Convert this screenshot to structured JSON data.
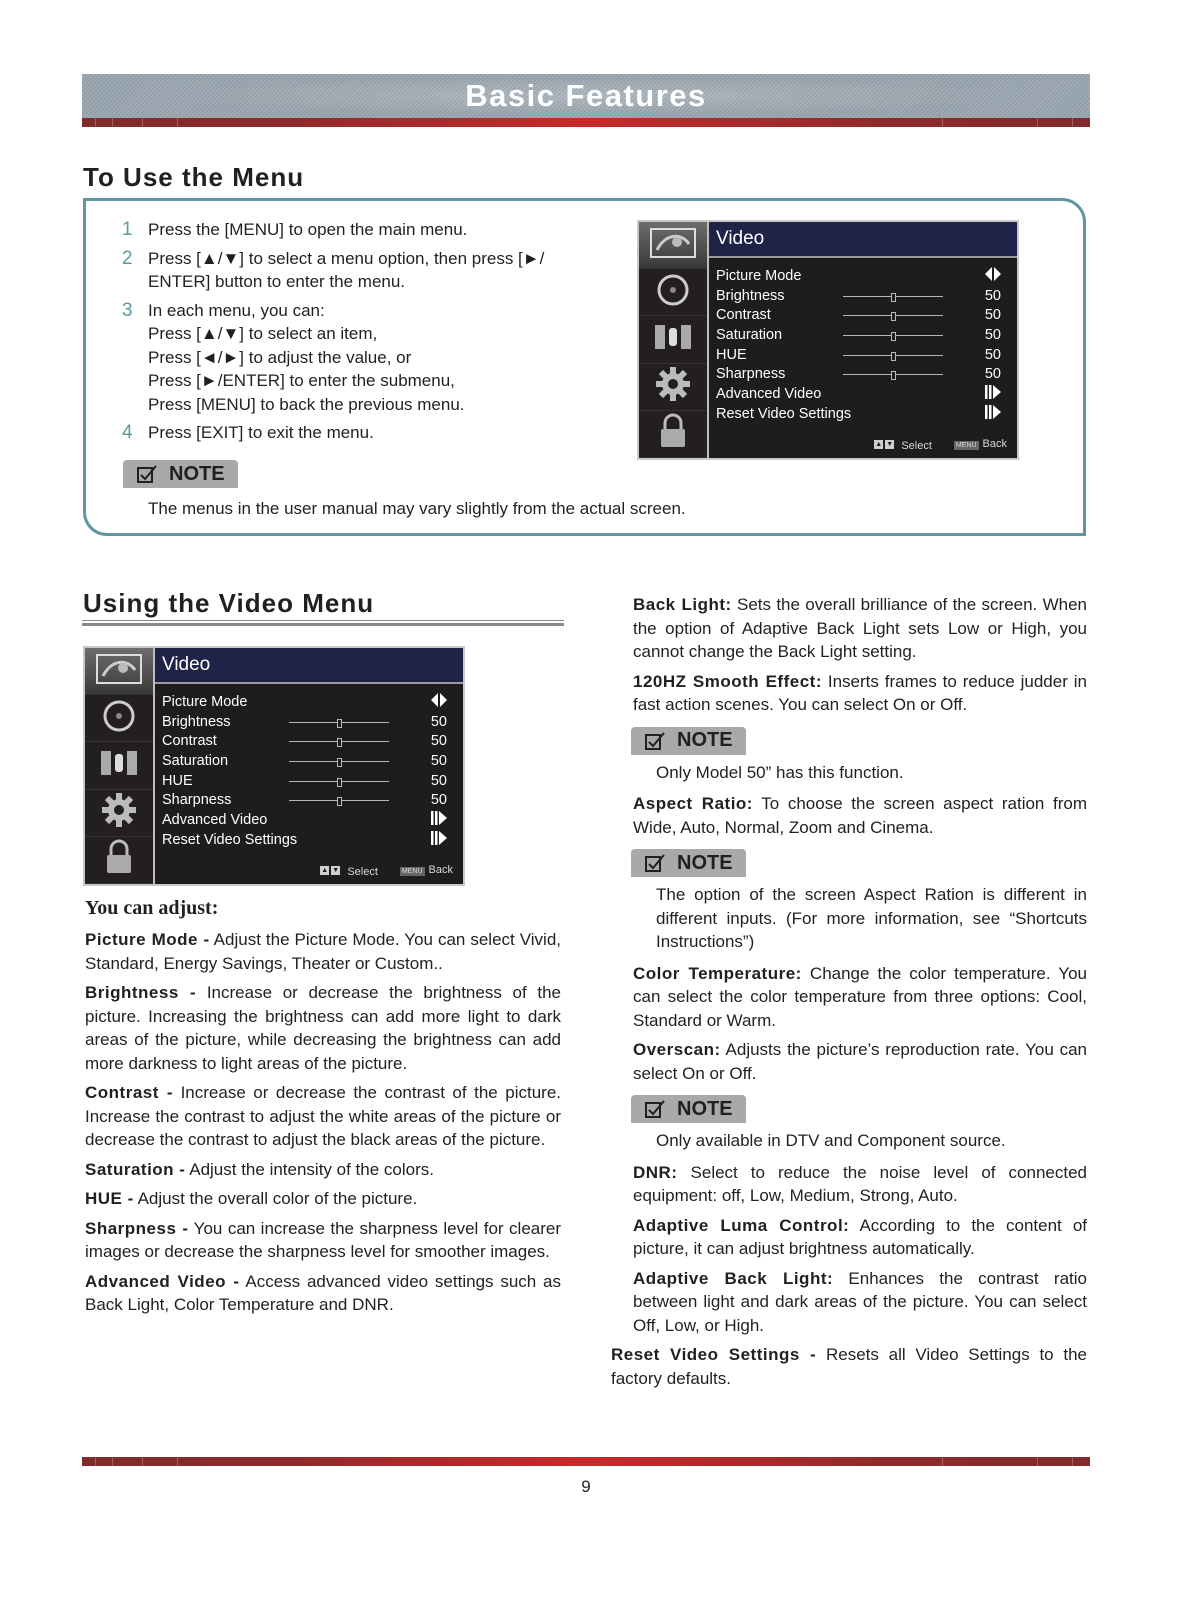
{
  "header": {
    "title": "Basic Features"
  },
  "section_menu": {
    "title": "To Use the Menu",
    "steps": [
      {
        "num": "1",
        "lines": [
          "Press the [MENU] to open the main menu."
        ]
      },
      {
        "num": "2",
        "lines": [
          "Press [▲/▼] to select a menu option, then press [►/",
          "ENTER] button to enter the menu."
        ]
      },
      {
        "num": "3",
        "lines": [
          "In each menu, you can:",
          "Press [▲/▼] to select an item,",
          "Press [◄/►] to adjust the value, or",
          "Press [►/ENTER] to enter the submenu,",
          "Press [MENU] to back the previous menu."
        ]
      },
      {
        "num": "4",
        "lines": [
          "Press [EXIT] to exit the menu."
        ]
      }
    ],
    "note_label": "NOTE",
    "note_text": "The menus in the user manual may vary slightly from the actual screen."
  },
  "osd_menu": {
    "title": "Video",
    "sidebar_icons": [
      "picture-icon",
      "sound-icon",
      "channel-icon",
      "setup-icon",
      "lock-icon"
    ],
    "rows": [
      {
        "label": "Picture Mode",
        "type": "toggle",
        "value": "◆"
      },
      {
        "label": "Brightness",
        "type": "slider",
        "value": "50",
        "level": 0.5
      },
      {
        "label": "Contrast",
        "type": "slider",
        "value": "50",
        "level": 0.5
      },
      {
        "label": "Saturation",
        "type": "slider",
        "value": "50",
        "level": 0.5
      },
      {
        "label": "HUE",
        "type": "slider",
        "value": "50",
        "level": 0.5
      },
      {
        "label": "Sharpness",
        "type": "slider",
        "value": "50",
        "level": 0.5
      },
      {
        "label": "Advanced Video",
        "type": "submenu",
        "value": ""
      },
      {
        "label": "Reset Video Settings",
        "type": "submenu",
        "value": ""
      }
    ],
    "footer": {
      "up": "▲",
      "down": "▼",
      "select_label": "Select",
      "menu_key": "MENU",
      "back_label": "Back"
    },
    "colors": {
      "title_bg": "#1f2348",
      "body_bg": "#1e1c1d"
    }
  },
  "section_video": {
    "title": "Using the Video Menu",
    "adjust_heading": "You can adjust:",
    "left_items": [
      {
        "term": "Picture Mode -",
        "text": " Adjust the Picture Mode. You can select Vivid, Standard, Energy Savings, Theater or Custom.."
      },
      {
        "term": "Brightness -",
        "text": " Increase or decrease the brightness of the picture. Increasing the brightness can add more light to dark areas of the picture, while decreasing the brightness can add more darkness to light areas of the picture."
      },
      {
        "term": "Contrast -",
        "text": " Increase or decrease the contrast of the picture. Increase the contrast to adjust the white areas of the picture or decrease the contrast to adjust the black areas of the picture."
      },
      {
        "term": "Saturation -",
        "text": " Adjust the intensity of the colors."
      },
      {
        "term": "HUE -",
        "text": " Adjust the overall color of the picture."
      },
      {
        "term": "Sharpness -",
        "text": " You can increase the sharpness level for clearer images or decrease the sharpness level for smoother images."
      },
      {
        "term": "Advanced Video -",
        "text": " Access advanced video settings such as Back Light, Color Temperature and DNR."
      }
    ],
    "right_items": [
      {
        "term": "Back Light:",
        "text": " Sets the overall brilliance of the screen. When the option of Adaptive Back Light sets Low or High, you cannot change the Back Light setting."
      },
      {
        "term": "120HZ Smooth Effect:",
        "text": " Inserts frames to reduce judder in fast action scenes. You can select On or Off."
      },
      {
        "note": "Only Model 50” has this function."
      },
      {
        "term": "Aspect Ratio:",
        "text": " To choose the screen aspect ration from Wide, Auto, Normal, Zoom and Cinema."
      },
      {
        "note": "The option of the screen Aspect Ration is different in different inputs. (For more information, see “Shortcuts Instructions”)"
      },
      {
        "term": "Color Temperature:",
        "text": " Change the color temperature. You can select the color temperature from three options: Cool, Standard or Warm."
      },
      {
        "term": "Overscan:",
        "text": " Adjusts the picture’s reproduction rate. You can select On or Off."
      },
      {
        "note": "Only available in DTV and Component source."
      },
      {
        "term": "DNR:",
        "text": " Select to reduce the noise level of connected equipment: off, Low, Medium, Strong, Auto."
      },
      {
        "term": "Adaptive Luma Control:",
        "text": " According to the content of picture, it can adjust brightness automatically."
      },
      {
        "term": "Adaptive Back Light:",
        "text": " Enhances the contrast ratio between light and dark areas of the picture. You can select Off, Low, or High."
      },
      {
        "term": "Reset Video Settings -",
        "text": " Resets all Video Settings to the factory defaults."
      }
    ],
    "note_label": "NOTE"
  },
  "footer": {
    "page_number": "9"
  },
  "colors": {
    "accent_teal": "#5e97a3",
    "banner_red": "#c72b29",
    "note_gray": "#a9a9a9"
  }
}
